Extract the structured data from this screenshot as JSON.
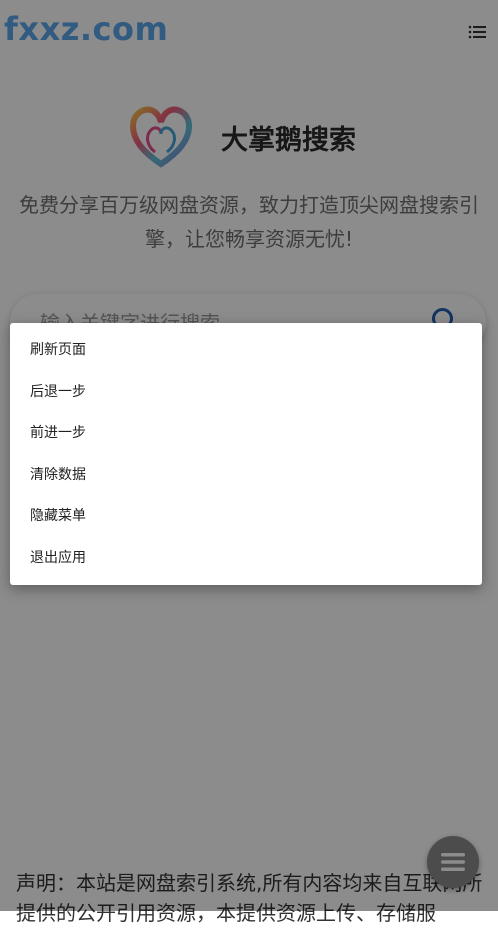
{
  "site": {
    "logo_text": "fxxz.com",
    "menu_icon": "list-menu-icon"
  },
  "brand": {
    "logo_icon": "swan-heart-logo",
    "title": "大掌鹅搜索"
  },
  "tagline": "免费分享百万级网盘资源，致力打造顶尖网盘搜索引擎，让您畅享资源无忧!",
  "search": {
    "placeholder": "输入关键字进行搜索",
    "icon": "search-icon"
  },
  "notice": "声明：本站是网盘索引系统,所有内容均来自互联网所提供的公开引用资源，本提供资源上传、存储服",
  "fab_icon": "menu-icon",
  "context_menu": {
    "items": [
      {
        "label": "刷新页面"
      },
      {
        "label": "后退一步"
      },
      {
        "label": "前进一步"
      },
      {
        "label": "清除数据"
      },
      {
        "label": "隐藏菜单"
      },
      {
        "label": "退出应用"
      }
    ]
  },
  "colors": {
    "logo_text": "#5aa6ea",
    "overlay": "rgba(0,0,0,0.45)"
  }
}
